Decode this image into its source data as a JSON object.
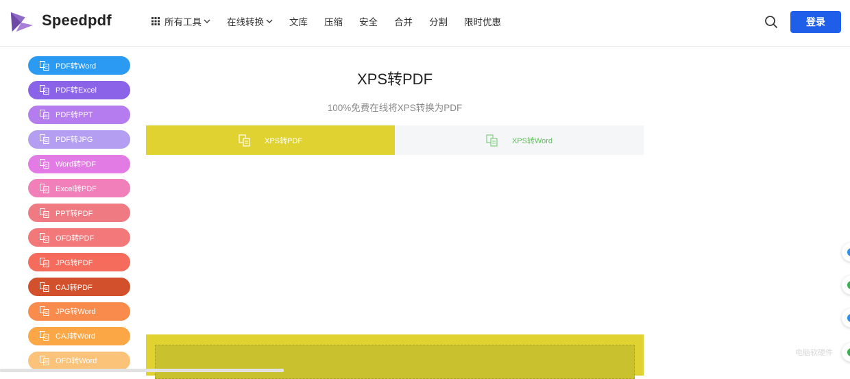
{
  "header": {
    "brand": "Speedpdf",
    "nav": [
      {
        "label": "所有工具",
        "has_grid": true,
        "has_chevron": true
      },
      {
        "label": "在线转换",
        "has_grid": false,
        "has_chevron": true
      },
      {
        "label": "文库"
      },
      {
        "label": "压缩"
      },
      {
        "label": "安全"
      },
      {
        "label": "合并"
      },
      {
        "label": "分割"
      },
      {
        "label": "限时优惠"
      }
    ],
    "login_label": "登录",
    "search_icon": "search-icon"
  },
  "sidebar": {
    "items": [
      {
        "label": "PDF转Word",
        "color": "#2b9af3"
      },
      {
        "label": "PDF转Excel",
        "color": "#8b63e8"
      },
      {
        "label": "PDF转PPT",
        "color": "#b57cf0"
      },
      {
        "label": "PDF转JPG",
        "color": "#b39ef2"
      },
      {
        "label": "Word转PDF",
        "color": "#e27be3"
      },
      {
        "label": "Excel转PDF",
        "color": "#f17fb9"
      },
      {
        "label": "PPT转PDF",
        "color": "#ef7a82"
      },
      {
        "label": "OFD转PDF",
        "color": "#f2787a"
      },
      {
        "label": "JPG转PDF",
        "color": "#f56b5c"
      },
      {
        "label": "CAJ转PDF",
        "color": "#d2502c"
      },
      {
        "label": "JPG转Word",
        "color": "#f98b4c"
      },
      {
        "label": "CAJ转Word",
        "color": "#fba745"
      },
      {
        "label": "OFD转Word",
        "color": "#fbc27a"
      }
    ]
  },
  "main": {
    "title": "XPS转PDF",
    "subtitle": "100%免费在线将XPS转换为PDF",
    "tabs": [
      {
        "label": "XPS转PDF",
        "active": true
      },
      {
        "label": "XPS转Word",
        "active": false
      }
    ]
  },
  "floating_buttons": [
    {
      "color": "#2b8ff0"
    },
    {
      "color": "#34b34a"
    },
    {
      "color": "#2b8ff0"
    },
    {
      "color": "#34b34a"
    }
  ],
  "watermark": "电脑软硬件"
}
